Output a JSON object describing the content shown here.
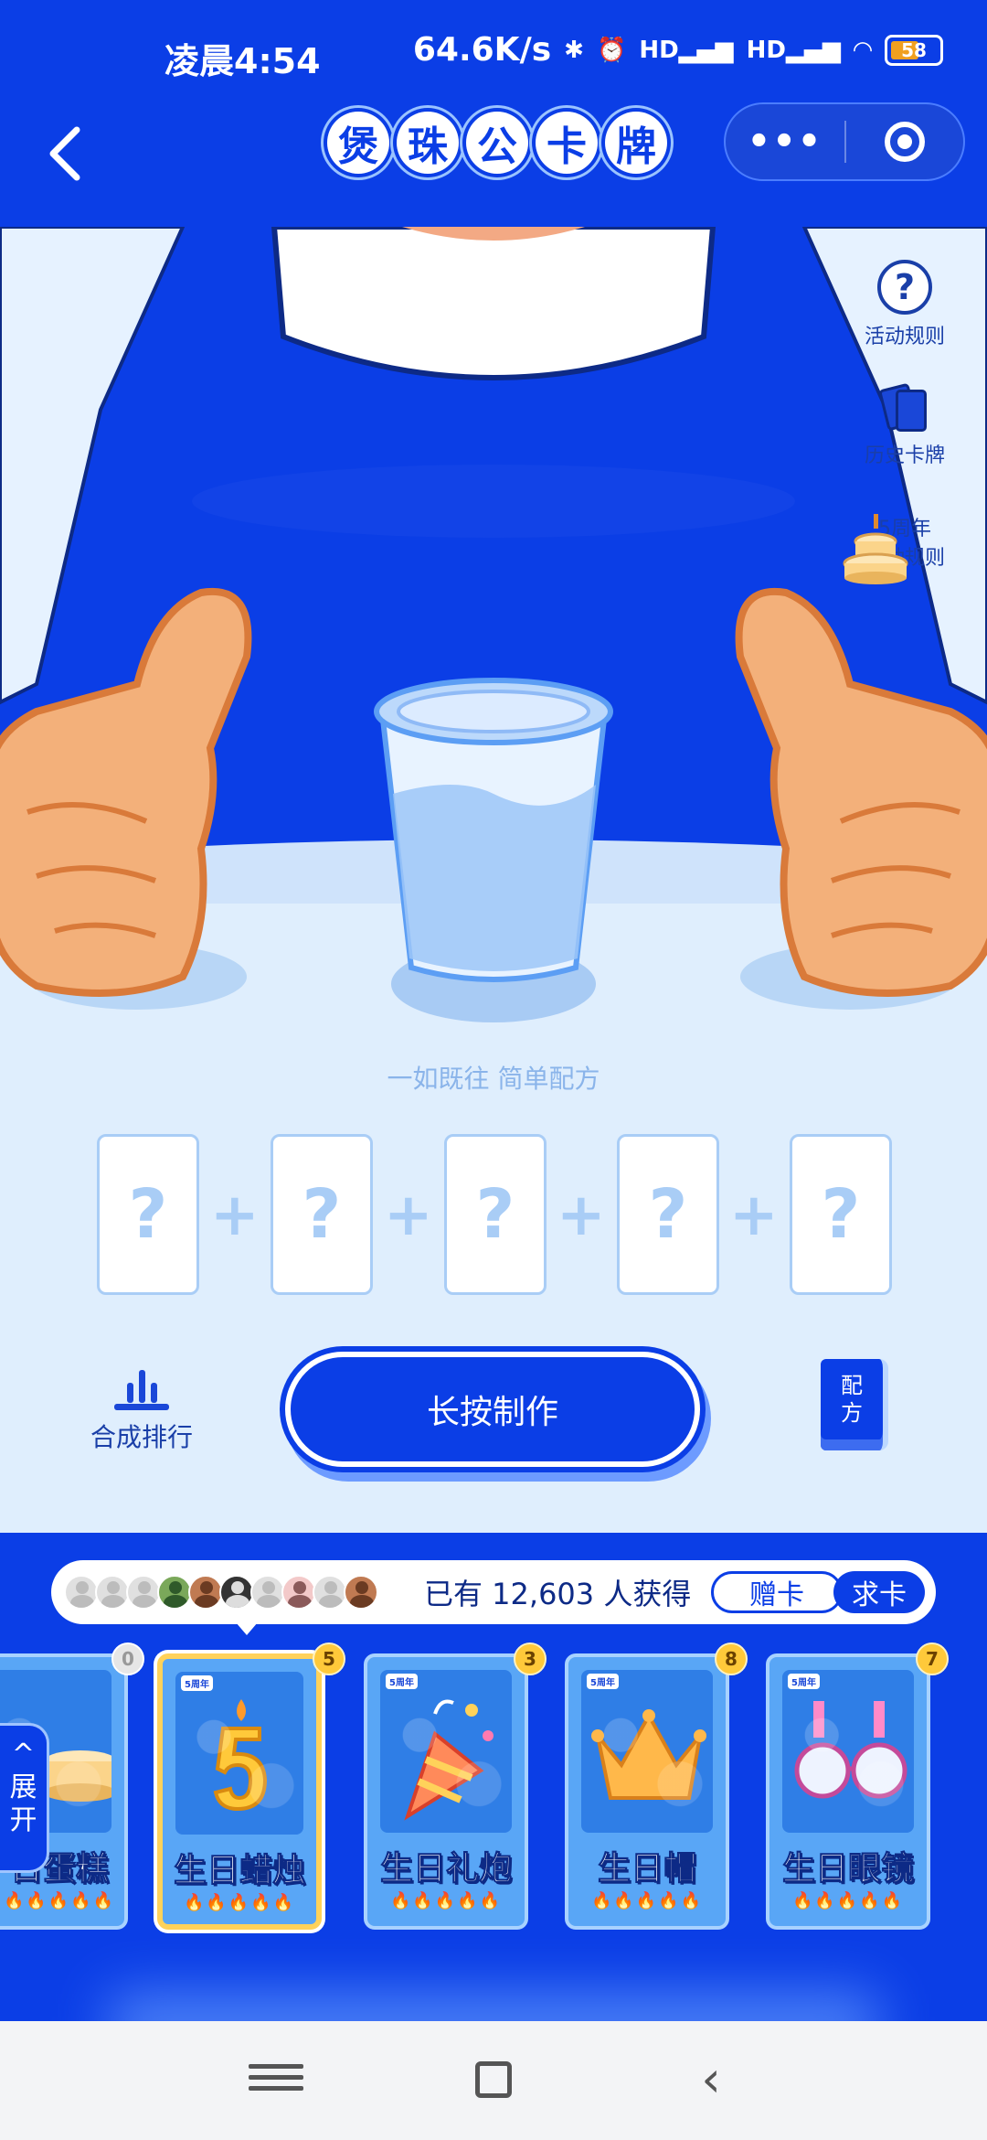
{
  "status_bar": {
    "time": "凌晨4:54",
    "net_speed": "64.6K/s",
    "signal_labels": [
      "HD",
      "HD"
    ],
    "battery": "58"
  },
  "nav": {
    "back_icon": "chevron-left-icon",
    "title_chars": [
      "煲",
      "珠",
      "公",
      "卡",
      "牌"
    ],
    "more_icon": "more-dots-icon",
    "close_icon": "target-circle-icon"
  },
  "side_links": {
    "rules": "活动规则",
    "history": "历史卡牌",
    "anniversary_line1": "5周年",
    "anniversary_line2": "活动规则"
  },
  "tagline": "一如既往 简单配方",
  "slots": [
    "?",
    "?",
    "?",
    "?",
    "?"
  ],
  "slot_operator": "+",
  "actions": {
    "ranking": "合成排行",
    "make_button": "长按制作",
    "recipe_line1": "配",
    "recipe_line2": "方"
  },
  "tray": {
    "owners_text": "已有 12,603 人获得",
    "gift_button": "赠卡",
    "ask_button": "求卡",
    "badge_text": "5周年",
    "cards": [
      {
        "name": "日蛋糕",
        "count": "0",
        "flames": "🔥🔥🔥🔥🔥",
        "selected": false
      },
      {
        "name": "生日蜡烛",
        "count": "5",
        "flames": "🔥🔥🔥🔥🔥",
        "selected": true
      },
      {
        "name": "生日礼炮",
        "count": "3",
        "flames": "🔥🔥🔥🔥🔥",
        "selected": false
      },
      {
        "name": "生日帽",
        "count": "8",
        "flames": "🔥🔥🔥🔥🔥",
        "selected": false
      },
      {
        "name": "生日眼镜",
        "count": "7",
        "flames": "🔥🔥🔥🔥🔥",
        "selected": false
      }
    ],
    "expand_line1": "展",
    "expand_line2": "开"
  },
  "system_nav": {
    "menu_icon": "menu-icon",
    "home_icon": "home-square-icon",
    "back_icon": "back-chevron-icon"
  },
  "colors": {
    "brand_blue": "#0b3ee6",
    "light_blue": "#dfeefd",
    "gold": "#ffc93a"
  }
}
